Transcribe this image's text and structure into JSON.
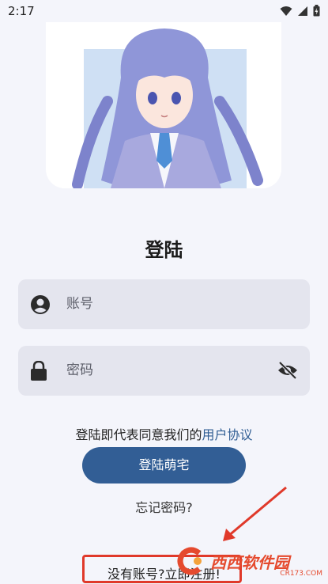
{
  "status_bar": {
    "time": "2:17",
    "icons": [
      "wifi-icon",
      "signal-icon",
      "battery-icon"
    ]
  },
  "login": {
    "title": "登陆",
    "account_placeholder": "账号",
    "password_placeholder": "密码",
    "agreement_prefix": "登陆即代表同意我们的",
    "agreement_link": "用户协议",
    "login_button": "登陆萌宅",
    "forgot_password": "忘记密码?",
    "register_prompt": "没有账号?立即注册!"
  },
  "watermark": {
    "brand": "西西软件园",
    "url": "CR173.COM"
  },
  "colors": {
    "primary": "#325e95",
    "field_bg": "#e4e5ee",
    "annotation": "#e0392a"
  }
}
